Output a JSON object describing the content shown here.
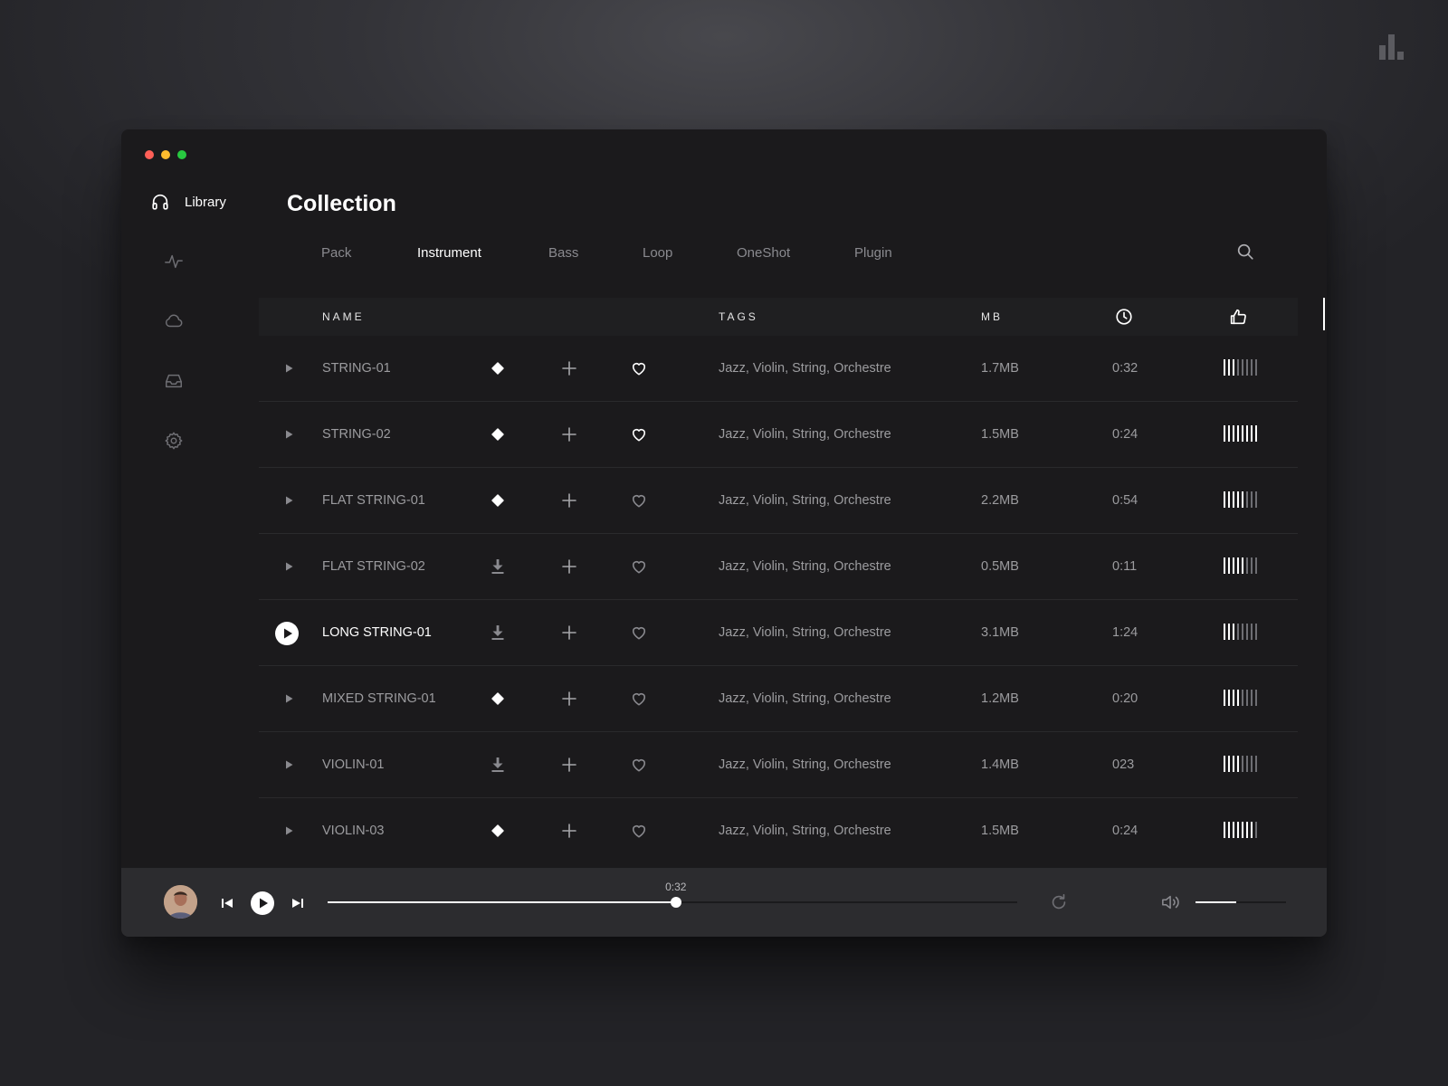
{
  "sidebar": {
    "items": [
      {
        "label": "Library",
        "icon": "headphones-icon"
      },
      {
        "label": "",
        "icon": "activity-icon"
      },
      {
        "label": "",
        "icon": "cloud-icon"
      },
      {
        "label": "",
        "icon": "inbox-icon"
      },
      {
        "label": "",
        "icon": "gear-icon"
      }
    ]
  },
  "header": {
    "title": "Collection"
  },
  "tabs": [
    {
      "label": "Pack",
      "active": false
    },
    {
      "label": "Instrument",
      "active": true
    },
    {
      "label": "Bass",
      "active": false
    },
    {
      "label": "Loop",
      "active": false
    },
    {
      "label": "OneShot",
      "active": false
    },
    {
      "label": "Plugin",
      "active": false
    }
  ],
  "table": {
    "columns": {
      "name": "NAME",
      "tags": "TAGS",
      "size": "MB",
      "duration_icon": "clock-icon",
      "rating_icon": "thumbs-up-icon"
    },
    "rows": [
      {
        "name": "STRING-01",
        "status": "downloaded",
        "liked": true,
        "tags": "Jazz, Violin, String, Orchestre",
        "size": "1.7MB",
        "duration": "0:32",
        "rating": 3,
        "playing": false
      },
      {
        "name": "STRING-02",
        "status": "downloaded",
        "liked": true,
        "tags": "Jazz, Violin, String, Orchestre",
        "size": "1.5MB",
        "duration": "0:24",
        "rating": 8,
        "playing": false
      },
      {
        "name": "FLAT STRING-01",
        "status": "downloaded",
        "liked": false,
        "tags": "Jazz, Violin, String, Orchestre",
        "size": "2.2MB",
        "duration": "0:54",
        "rating": 5,
        "playing": false
      },
      {
        "name": "FLAT STRING-02",
        "status": "download",
        "liked": false,
        "tags": "Jazz, Violin, String, Orchestre",
        "size": "0.5MB",
        "duration": "0:11",
        "rating": 5,
        "playing": false
      },
      {
        "name": "LONG STRING-01",
        "status": "download",
        "liked": false,
        "tags": "Jazz, Violin, String, Orchestre",
        "size": "3.1MB",
        "duration": "1:24",
        "rating": 3,
        "playing": true
      },
      {
        "name": "MIXED STRING-01",
        "status": "downloaded",
        "liked": false,
        "tags": "Jazz, Violin, String, Orchestre",
        "size": "1.2MB",
        "duration": "0:20",
        "rating": 4,
        "playing": false
      },
      {
        "name": "VIOLIN-01",
        "status": "download",
        "liked": false,
        "tags": "Jazz, Violin, String, Orchestre",
        "size": "1.4MB",
        "duration": "023",
        "rating": 4,
        "playing": false
      },
      {
        "name": "VIOLIN-03",
        "status": "downloaded",
        "liked": false,
        "tags": "Jazz, Violin, String, Orchestre",
        "size": "1.5MB",
        "duration": "0:24",
        "rating": 7,
        "playing": false
      }
    ],
    "rating_max": 8
  },
  "player": {
    "current_time": "0:32",
    "progress": 0.505,
    "volume": 0.45
  },
  "colors": {
    "traffic_close": "#ff5f57",
    "traffic_minimize": "#febc2e",
    "traffic_zoom": "#28c840",
    "accent": "#ffffff",
    "muted_text": "#9c9c9f"
  }
}
